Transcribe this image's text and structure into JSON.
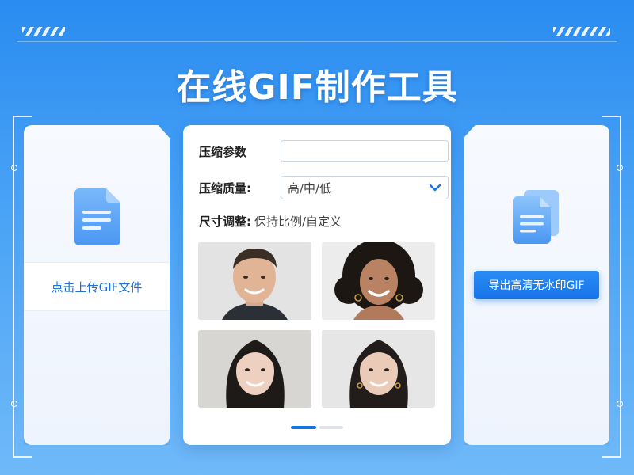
{
  "page": {
    "title": "在线GIF制作工具"
  },
  "left_panel": {
    "upload_label": "点击上传GIF文件",
    "icon": "document-icon"
  },
  "settings": {
    "compress_params_label": "压缩参数",
    "compress_params_value": "",
    "quality_label": "压缩质量:",
    "quality_value": "高/中/低",
    "resize_label": "尺寸调整:",
    "resize_value": "保持比例/自定义"
  },
  "previews": [
    {
      "subject": "smiling man with short dark hair"
    },
    {
      "subject": "smiling woman with curly hair"
    },
    {
      "subject": "smiling woman with long dark hair"
    },
    {
      "subject": "smiling woman with long dark hair"
    }
  ],
  "pager": {
    "pages": 2,
    "active": 1
  },
  "right_panel": {
    "export_label": "导出高清无水印GIF",
    "icon": "copy-documents-icon"
  },
  "colors": {
    "accent": "#1673e8",
    "background": "#2a8cf0",
    "icon_blue": "#5aa6f5"
  }
}
